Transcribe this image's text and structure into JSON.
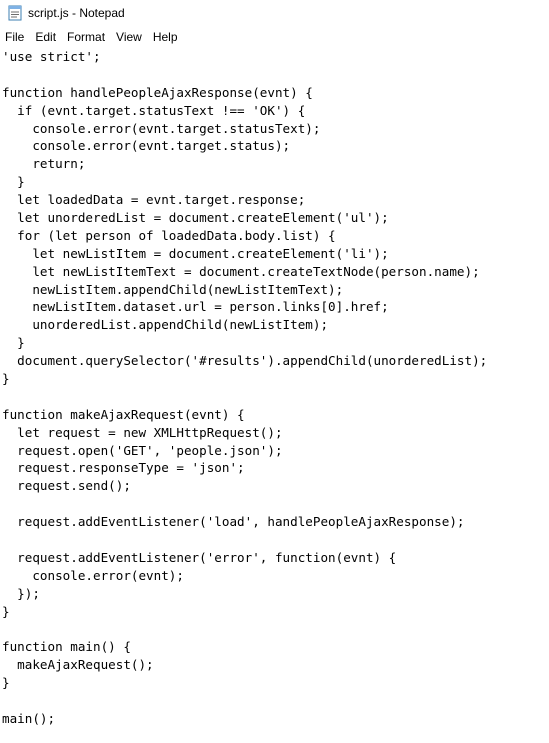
{
  "window": {
    "title": "script.js - Notepad",
    "icon": "notepad-file-icon"
  },
  "menu": {
    "items": [
      "File",
      "Edit",
      "Format",
      "View",
      "Help"
    ]
  },
  "editor": {
    "lines": [
      "'use strict';",
      "",
      "function handlePeopleAjaxResponse(evnt) {",
      "  if (evnt.target.statusText !== 'OK') {",
      "    console.error(evnt.target.statusText);",
      "    console.error(evnt.target.status);",
      "    return;",
      "  }",
      "  let loadedData = evnt.target.response;",
      "  let unorderedList = document.createElement('ul');",
      "  for (let person of loadedData.body.list) {",
      "    let newListItem = document.createElement('li');",
      "    let newListItemText = document.createTextNode(person.name);",
      "    newListItem.appendChild(newListItemText);",
      "    newListItem.dataset.url = person.links[0].href;",
      "    unorderedList.appendChild(newListItem);",
      "  }",
      "  document.querySelector('#results').appendChild(unorderedList);",
      "}",
      "",
      "function makeAjaxRequest(evnt) {",
      "  let request = new XMLHttpRequest();",
      "  request.open('GET', 'people.json');",
      "  request.responseType = 'json';",
      "  request.send();",
      "",
      "  request.addEventListener('load', handlePeopleAjaxResponse);",
      "",
      "  request.addEventListener('error', function(evnt) {",
      "    console.error(evnt);",
      "  });",
      "}",
      "",
      "function main() {",
      "  makeAjaxRequest();",
      "}",
      "",
      "main();"
    ]
  }
}
